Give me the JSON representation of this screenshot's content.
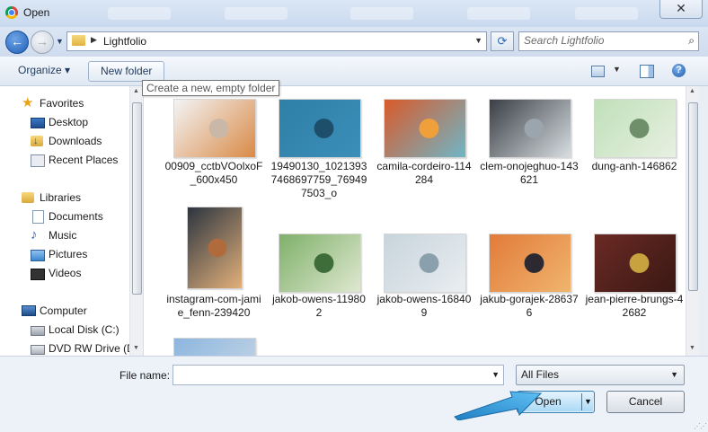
{
  "window": {
    "title": "Open",
    "close_glyph": "✕"
  },
  "nav": {
    "address_crumb": "Lightfolio",
    "search_placeholder": "Search Lightfolio",
    "back_icon": "back-arrow-icon",
    "forward_icon": "forward-arrow-icon",
    "refresh_icon": "refresh-icon",
    "search_icon": "magnifier-icon"
  },
  "toolbar": {
    "organize_label": "Organize ▾",
    "new_folder_label": "New folder",
    "tooltip": "Create a new, empty folder",
    "help_label": "?"
  },
  "sidebar": {
    "favorites": "Favorites",
    "desktop": "Desktop",
    "downloads": "Downloads",
    "recent_places": "Recent Places",
    "libraries": "Libraries",
    "documents": "Documents",
    "music": "Music",
    "pictures": "Pictures",
    "videos": "Videos",
    "computer": "Computer",
    "local_disk": "Local Disk (C:)",
    "dvd_drive": "DVD RW Drive (D"
  },
  "files": [
    {
      "name": "00909_cctbVOolxoF_600x450",
      "thumb_colors": [
        "#f3f4f6",
        "#c9b8a8",
        "#d98a46"
      ]
    },
    {
      "name": "19490130_10213937468697759_769497503_o",
      "thumb_colors": [
        "#2f7fa8",
        "#1d4f6b",
        "#3b8fb8"
      ]
    },
    {
      "name": "camila-cordeiro-114284",
      "thumb_colors": [
        "#d95a2b",
        "#f0a03a",
        "#6fb6c6"
      ]
    },
    {
      "name": "clem-onojeghuo-143621",
      "thumb_colors": [
        "#3a3f45",
        "#9aa5ad",
        "#d8dde2"
      ]
    },
    {
      "name": "dung-anh-146862",
      "thumb_colors": [
        "#bfe0b8",
        "#6f8f6a",
        "#e8f0e2"
      ]
    },
    {
      "name": "instagram-com-jamie_fenn-239420",
      "thumb_colors": [
        "#2c3540",
        "#b06a3c",
        "#e3b07a"
      ]
    },
    {
      "name": "jakob-owens-119802",
      "thumb_colors": [
        "#7fb06a",
        "#3f6d3a",
        "#dfe8d0"
      ]
    },
    {
      "name": "jakob-owens-168409",
      "thumb_colors": [
        "#c8d4dc",
        "#8aa0ad",
        "#e9eef1"
      ]
    },
    {
      "name": "jakub-gorajek-286376",
      "thumb_colors": [
        "#e27b3a",
        "#2c2a30",
        "#f0b56e"
      ]
    },
    {
      "name": "jean-pierre-brungs-42682",
      "thumb_colors": [
        "#6b2a24",
        "#c8a23e",
        "#3a1814"
      ]
    },
    {
      "name": "",
      "thumb_colors": [
        "#8cb6df",
        "#f2f6fa",
        "#cdd9e6"
      ]
    }
  ],
  "bottom": {
    "file_name_label": "File name:",
    "file_name_value": "",
    "filter_label": "All Files",
    "open_label": "Open",
    "cancel_label": "Cancel"
  },
  "colors": {
    "accent": "#3c7fb1",
    "open_highlight": "#a9d8f5",
    "pointer": "#2f9bdc"
  }
}
